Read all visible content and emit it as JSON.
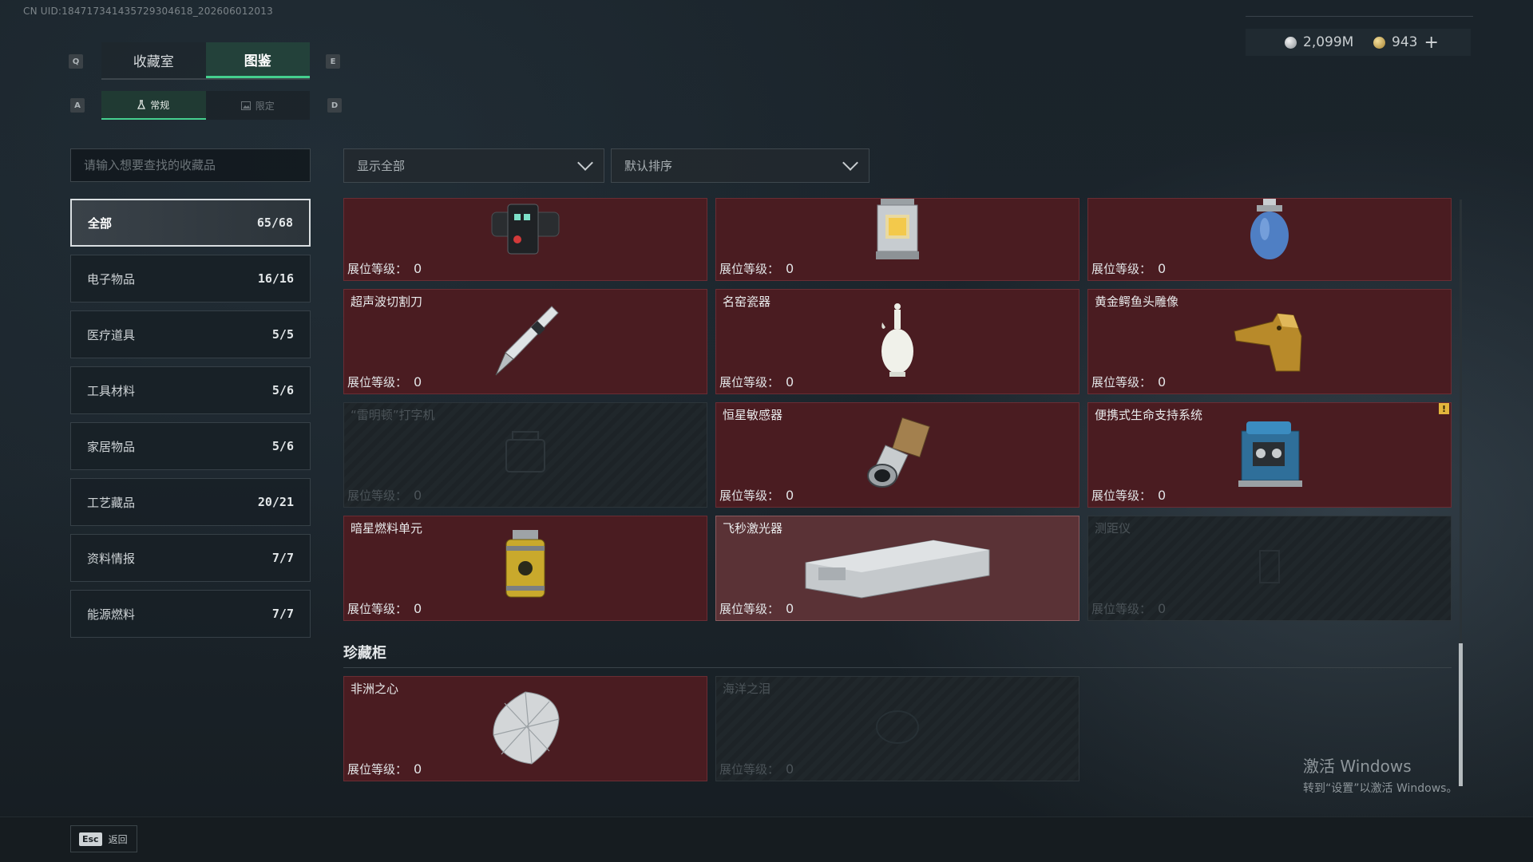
{
  "header": {
    "uid": "CN UID:184717341435729304618_202606012013",
    "key_q": "Q",
    "key_e": "E",
    "key_a": "A",
    "key_d": "D",
    "tabs": [
      {
        "label": "收藏室"
      },
      {
        "label": "图鉴"
      }
    ],
    "subtabs": [
      {
        "label": "常规"
      },
      {
        "label": "限定"
      }
    ],
    "currency": {
      "silver": "2,099M",
      "gold": "943",
      "plus": "+"
    }
  },
  "search": {
    "placeholder": "请输入想要查找的收藏品"
  },
  "filters": {
    "show": "显示全部",
    "sort": "默认排序"
  },
  "categories": [
    {
      "label": "全部",
      "count": "65/68"
    },
    {
      "label": "电子物品",
      "count": "16/16"
    },
    {
      "label": "医疗道具",
      "count": "5/5"
    },
    {
      "label": "工具材料",
      "count": "5/6"
    },
    {
      "label": "家居物品",
      "count": "5/6"
    },
    {
      "label": "工艺藏品",
      "count": "20/21"
    },
    {
      "label": "资料情报",
      "count": "7/7"
    },
    {
      "label": "能源燃料",
      "count": "7/7"
    }
  ],
  "level_label": "展位等级：",
  "items": [
    {
      "name": "",
      "level": "0",
      "icon": "smartwatch-device-icon"
    },
    {
      "name": "",
      "level": "0",
      "icon": "lantern-icon"
    },
    {
      "name": "",
      "level": "0",
      "icon": "gas-canister-icon"
    },
    {
      "name": "超声波切割刀",
      "level": "0",
      "icon": "ultrasonic-knife-icon"
    },
    {
      "name": "名窑瓷器",
      "level": "0",
      "icon": "porcelain-vase-icon"
    },
    {
      "name": "黄金鳄鱼头雕像",
      "level": "0",
      "icon": "gold-crocodile-head-icon"
    },
    {
      "name": "“雷明顿”打字机",
      "level": "0",
      "icon": "typewriter-icon"
    },
    {
      "name": "恒星敏感器",
      "level": "0",
      "icon": "star-sensor-icon"
    },
    {
      "name": "便携式生命支持系统",
      "level": "0",
      "icon": "life-support-icon"
    },
    {
      "name": "暗星燃料单元",
      "level": "0",
      "icon": "fuel-cell-icon"
    },
    {
      "name": "飞秒激光器",
      "level": "0",
      "icon": "femtosecond-laser-icon"
    },
    {
      "name": "测距仪",
      "level": "0",
      "icon": "rangefinder-icon"
    }
  ],
  "treasure": {
    "title": "珍藏柜",
    "items": [
      {
        "name": "非洲之心",
        "level": "0",
        "icon": "diamond-icon"
      },
      {
        "name": "海洋之泪",
        "level": "0",
        "icon": "ocean-tear-icon"
      }
    ]
  },
  "warning_mark": "!",
  "footer": {
    "esc_key": "Esc",
    "back_label": "返回"
  },
  "watermark": {
    "line1": "激活 Windows",
    "line2": "转到“设置”以激活 Windows。"
  },
  "colors": {
    "accent": "#45d08e",
    "owned_card": "#4a1c21",
    "warning": "#e2b63c"
  }
}
